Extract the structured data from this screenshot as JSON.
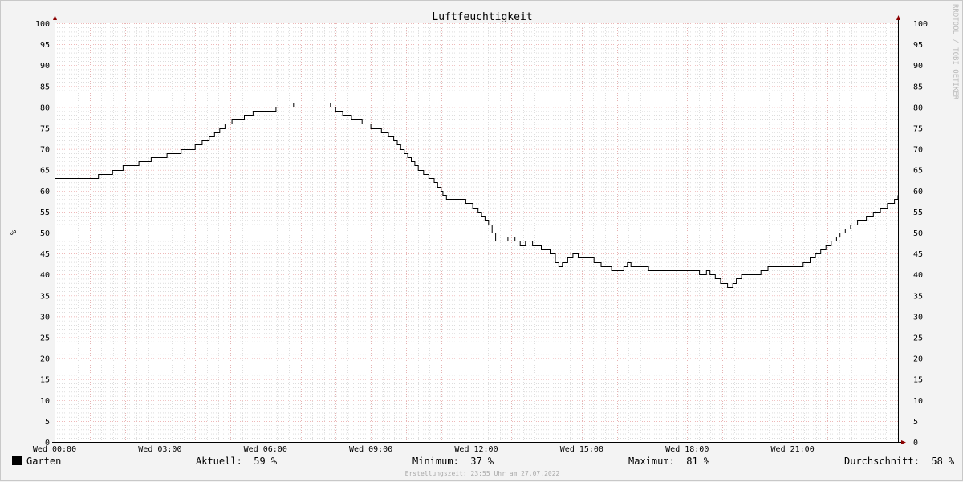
{
  "chart_data": {
    "type": "line",
    "title": "Luftfeuchtigkeit",
    "ylabel": "%",
    "xlabel": "",
    "ylim": [
      0,
      100
    ],
    "yticks": [
      0,
      5,
      10,
      15,
      20,
      25,
      30,
      35,
      40,
      45,
      50,
      55,
      60,
      65,
      70,
      75,
      80,
      85,
      90,
      95,
      100
    ],
    "xlim": [
      0,
      24
    ],
    "xticks": [
      {
        "hour": 0,
        "label": "Wed 00:00"
      },
      {
        "hour": 3,
        "label": "Wed 03:00"
      },
      {
        "hour": 6,
        "label": "Wed 06:00"
      },
      {
        "hour": 9,
        "label": "Wed 09:00"
      },
      {
        "hour": 12,
        "label": "Wed 12:00"
      },
      {
        "hour": 15,
        "label": "Wed 15:00"
      },
      {
        "hour": 18,
        "label": "Wed 18:00"
      },
      {
        "hour": 21,
        "label": "Wed 21:00"
      }
    ],
    "grid": true,
    "series": [
      {
        "name": "Garten",
        "color": "#000000",
        "x": [
          0,
          1.25,
          1.65,
          1.95,
          2.4,
          2.75,
          3.2,
          3.6,
          4.0,
          4.2,
          4.4,
          4.55,
          4.7,
          4.85,
          5.05,
          5.4,
          5.65,
          5.85,
          6.3,
          6.8,
          7.7,
          7.85,
          8.0,
          8.2,
          8.45,
          8.75,
          9.0,
          9.3,
          9.5,
          9.65,
          9.75,
          9.85,
          9.95,
          10.05,
          10.15,
          10.25,
          10.35,
          10.5,
          10.65,
          10.8,
          10.9,
          11.0,
          11.05,
          11.15,
          11.4,
          11.7,
          11.8,
          11.9,
          12.05,
          12.15,
          12.25,
          12.35,
          12.45,
          12.55,
          12.7,
          12.9,
          13.1,
          13.25,
          13.4,
          13.6,
          13.85,
          14.1,
          14.25,
          14.35,
          14.45,
          14.6,
          14.75,
          14.9,
          15.05,
          15.2,
          15.35,
          15.55,
          15.85,
          16.2,
          16.3,
          16.4,
          16.9,
          17.0,
          17.6,
          18.0,
          18.35,
          18.55,
          18.65,
          18.8,
          18.95,
          19.15,
          19.3,
          19.4,
          19.55,
          19.7,
          20.1,
          20.3,
          20.5,
          20.9,
          21.3,
          21.5,
          21.65,
          21.8,
          21.95,
          22.1,
          22.25,
          22.35,
          22.5,
          22.65,
          22.85,
          23.1,
          23.3,
          23.5,
          23.7,
          23.9,
          24.0
        ],
        "values": [
          63,
          64,
          65,
          66,
          67,
          68,
          69,
          70,
          71,
          72,
          73,
          74,
          75,
          76,
          77,
          78,
          79,
          79,
          80,
          81,
          81,
          80,
          79,
          78,
          77,
          76,
          75,
          74,
          73,
          72,
          71,
          70,
          69,
          68,
          67,
          66,
          65,
          64,
          63,
          62,
          61,
          60,
          59,
          58,
          58,
          57,
          57,
          56,
          55,
          54,
          53,
          52,
          50,
          48,
          48,
          49,
          48,
          47,
          48,
          47,
          46,
          45,
          43,
          42,
          43,
          44,
          45,
          44,
          44,
          44,
          43,
          42,
          41,
          42,
          43,
          42,
          41,
          41,
          41,
          41,
          40,
          41,
          40,
          39,
          38,
          37,
          38,
          39,
          40,
          40,
          41,
          42,
          42,
          42,
          43,
          44,
          45,
          46,
          47,
          48,
          49,
          50,
          51,
          52,
          53,
          54,
          55,
          56,
          57,
          58,
          59
        ]
      }
    ]
  },
  "legend": {
    "series_name": "Garten",
    "swatch_color": "#000000",
    "current_label": "Aktuell:",
    "current_value": "59 %",
    "min_label": "Minimum:",
    "min_value": "37 %",
    "max_label": "Maximum:",
    "max_value": "81 %",
    "avg_label": "Durchschnitt:",
    "avg_value": "58 %"
  },
  "footer": "Erstellungszeit: 23:55 Uhr am 27.07.2022",
  "watermark": "RRDTOOL / TOBI OETIKER",
  "colors": {
    "background": "#f3f3f3",
    "plot_background": "#ffffff",
    "major_grid": "#e8a0a0",
    "minor_grid": "#c8c8c8",
    "axis": "#000000",
    "arrow": "#8b0000"
  }
}
